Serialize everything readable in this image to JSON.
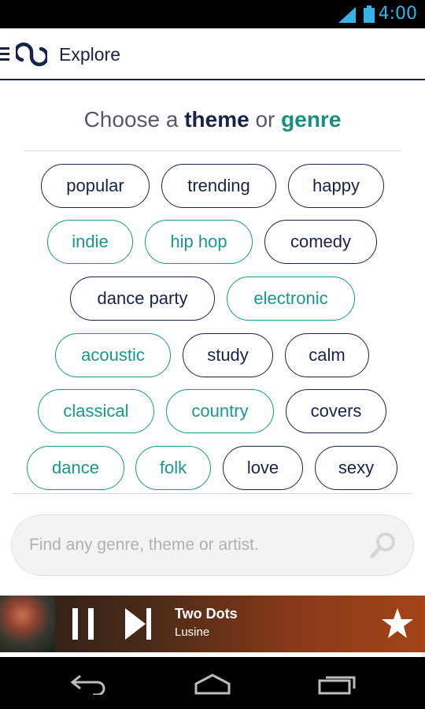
{
  "status_bar": {
    "time": "4:00"
  },
  "app_bar": {
    "title": "Explore"
  },
  "heading": {
    "prefix": "Choose a ",
    "theme": "theme",
    "middle": " or ",
    "genre": "genre"
  },
  "chips": [
    {
      "label": "popular",
      "kind": "theme"
    },
    {
      "label": "trending",
      "kind": "theme"
    },
    {
      "label": "happy",
      "kind": "theme"
    },
    {
      "label": "indie",
      "kind": "genre"
    },
    {
      "label": "hip hop",
      "kind": "genre"
    },
    {
      "label": "comedy",
      "kind": "theme"
    },
    {
      "label": "dance party",
      "kind": "theme"
    },
    {
      "label": "electronic",
      "kind": "genre"
    },
    {
      "label": "acoustic",
      "kind": "genre"
    },
    {
      "label": "study",
      "kind": "theme"
    },
    {
      "label": "calm",
      "kind": "theme"
    },
    {
      "label": "classical",
      "kind": "genre"
    },
    {
      "label": "country",
      "kind": "genre"
    },
    {
      "label": "covers",
      "kind": "theme"
    },
    {
      "label": "dance",
      "kind": "genre"
    },
    {
      "label": "folk",
      "kind": "genre"
    },
    {
      "label": "love",
      "kind": "theme"
    },
    {
      "label": "sexy",
      "kind": "theme"
    }
  ],
  "search": {
    "placeholder": "Find any genre, theme or artist.",
    "value": "",
    "icon": "search-icon"
  },
  "now_playing": {
    "track": "Two Dots",
    "artist": "Lusine",
    "progress": 0.99,
    "icons": [
      "pause-icon",
      "next-icon",
      "star-icon"
    ]
  },
  "colors": {
    "theme": "#17234a",
    "genre": "#17998a",
    "status_clock": "#33b5e5"
  },
  "nav_bar": {
    "icons": [
      "back-icon",
      "home-icon",
      "recent-apps-icon"
    ]
  }
}
